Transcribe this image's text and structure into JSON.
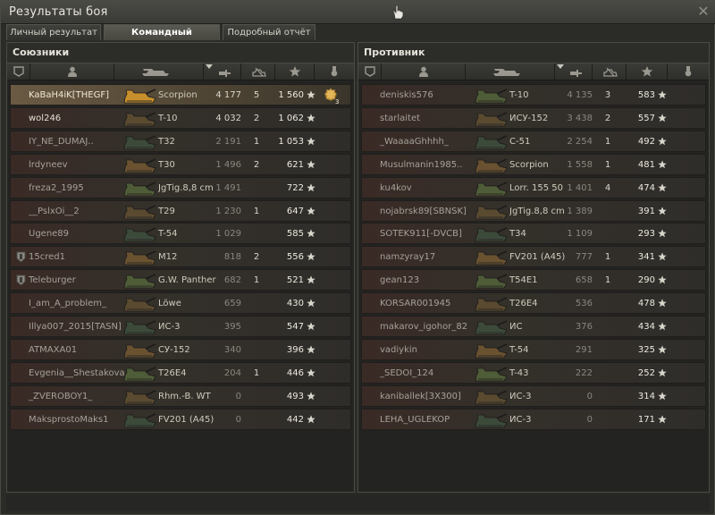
{
  "window": {
    "title": "Результаты боя"
  },
  "tabs": [
    {
      "label": "Личный результат",
      "active": false
    },
    {
      "label": "Командный результат",
      "active": true
    },
    {
      "label": "Подробный отчёт",
      "active": false
    }
  ],
  "colors": {
    "highlight_row": "#6a5a44",
    "row_bg": "#34302a",
    "text_light": "#ece9df",
    "text_dim": "#8a877f"
  },
  "columns": [
    "squad-icon",
    "player-icon",
    "vehicle-icon",
    "damage-icon",
    "kills-icon",
    "xp-star-icon",
    "medal-icon"
  ],
  "allies": {
    "header": "Союзники",
    "rows": [
      {
        "player": "KaBaH4iK[THEGF]",
        "vehicle": "Scorpion",
        "damage": "4 177",
        "kills": "5",
        "xp": "1 560",
        "highlight": true,
        "medal": true,
        "medal_count": "3"
      },
      {
        "player": "wol246",
        "vehicle": "T-10",
        "damage": "4 032",
        "kills": "2",
        "xp": "1 062",
        "bright": true
      },
      {
        "player": "IY_NE_DUMAJ..",
        "vehicle": "T32",
        "damage": "2 191",
        "kills": "1",
        "xp": "1 053"
      },
      {
        "player": "lrdyneev",
        "vehicle": "T30",
        "damage": "1 496",
        "kills": "2",
        "xp": "621"
      },
      {
        "player": "freza2_1995",
        "vehicle": "JgTig.8,8 cm",
        "damage": "1 491",
        "kills": "",
        "xp": "722"
      },
      {
        "player": "__PslxOi__2",
        "vehicle": "T29",
        "damage": "1 230",
        "kills": "1",
        "xp": "647"
      },
      {
        "player": "Ugene89",
        "vehicle": "T-54",
        "damage": "1 029",
        "kills": "",
        "xp": "585"
      },
      {
        "player": "15cred1",
        "vehicle": "M12",
        "damage": "818",
        "kills": "2",
        "xp": "556",
        "squad": true
      },
      {
        "player": "Teleburger",
        "vehicle": "G.W. Panther",
        "damage": "682",
        "kills": "1",
        "xp": "521",
        "squad": true
      },
      {
        "player": "I_am_A_problem_",
        "vehicle": "Löwe",
        "damage": "659",
        "kills": "",
        "xp": "430"
      },
      {
        "player": "Illya007_2015[TASN]",
        "vehicle": "ИС-3",
        "damage": "395",
        "kills": "",
        "xp": "547"
      },
      {
        "player": "ATMAXA01",
        "vehicle": "СУ-152",
        "damage": "340",
        "kills": "",
        "xp": "396"
      },
      {
        "player": "Evgenia__Shestakova",
        "vehicle": "T26E4",
        "damage": "204",
        "kills": "1",
        "xp": "446"
      },
      {
        "player": "_ZVEROBOY1_",
        "vehicle": "Rhm.-B. WT",
        "damage": "0",
        "kills": "",
        "xp": "493"
      },
      {
        "player": "MaksprostoMaks1",
        "vehicle": "FV201 (A45)",
        "damage": "0",
        "kills": "",
        "xp": "442"
      }
    ]
  },
  "enemies": {
    "header": "Противник",
    "rows": [
      {
        "player": "deniskis576",
        "vehicle": "T-10",
        "damage": "4 135",
        "kills": "3",
        "xp": "583"
      },
      {
        "player": "starlaitet",
        "vehicle": "ИСУ-152",
        "damage": "3 438",
        "kills": "2",
        "xp": "557"
      },
      {
        "player": "_WaaaaGhhhh_",
        "vehicle": "С-51",
        "damage": "2 254",
        "kills": "1",
        "xp": "492"
      },
      {
        "player": "Musulmanin1985..",
        "vehicle": "Scorpion",
        "damage": "1 558",
        "kills": "1",
        "xp": "481"
      },
      {
        "player": "ku4kov",
        "vehicle": "Lorr. 155 50",
        "damage": "1 401",
        "kills": "4",
        "xp": "474"
      },
      {
        "player": "nojabrsk89[SBNSK]",
        "vehicle": "JgTig.8,8 cm",
        "damage": "1 389",
        "kills": "",
        "xp": "391"
      },
      {
        "player": "SOTEK911[-DVCB]",
        "vehicle": "T34",
        "damage": "1 109",
        "kills": "",
        "xp": "293"
      },
      {
        "player": "namzyray17",
        "vehicle": "FV201 (A45)",
        "damage": "777",
        "kills": "1",
        "xp": "341"
      },
      {
        "player": "gean123",
        "vehicle": "T54E1",
        "damage": "658",
        "kills": "1",
        "xp": "290"
      },
      {
        "player": "KORSAR001945",
        "vehicle": "T26E4",
        "damage": "536",
        "kills": "",
        "xp": "478"
      },
      {
        "player": "makarov_igohor_82",
        "vehicle": "ИС",
        "damage": "376",
        "kills": "",
        "xp": "434"
      },
      {
        "player": "vadiykin",
        "vehicle": "T-54",
        "damage": "291",
        "kills": "",
        "xp": "325"
      },
      {
        "player": "_SEDOI_124",
        "vehicle": "T-43",
        "damage": "222",
        "kills": "",
        "xp": "252"
      },
      {
        "player": "kaniballek[3X300]",
        "vehicle": "ИС-3",
        "damage": "0",
        "kills": "",
        "xp": "314"
      },
      {
        "player": "LEHA_UGLEKOP",
        "vehicle": "ИС-3",
        "damage": "0",
        "kills": "",
        "xp": "171"
      }
    ]
  }
}
